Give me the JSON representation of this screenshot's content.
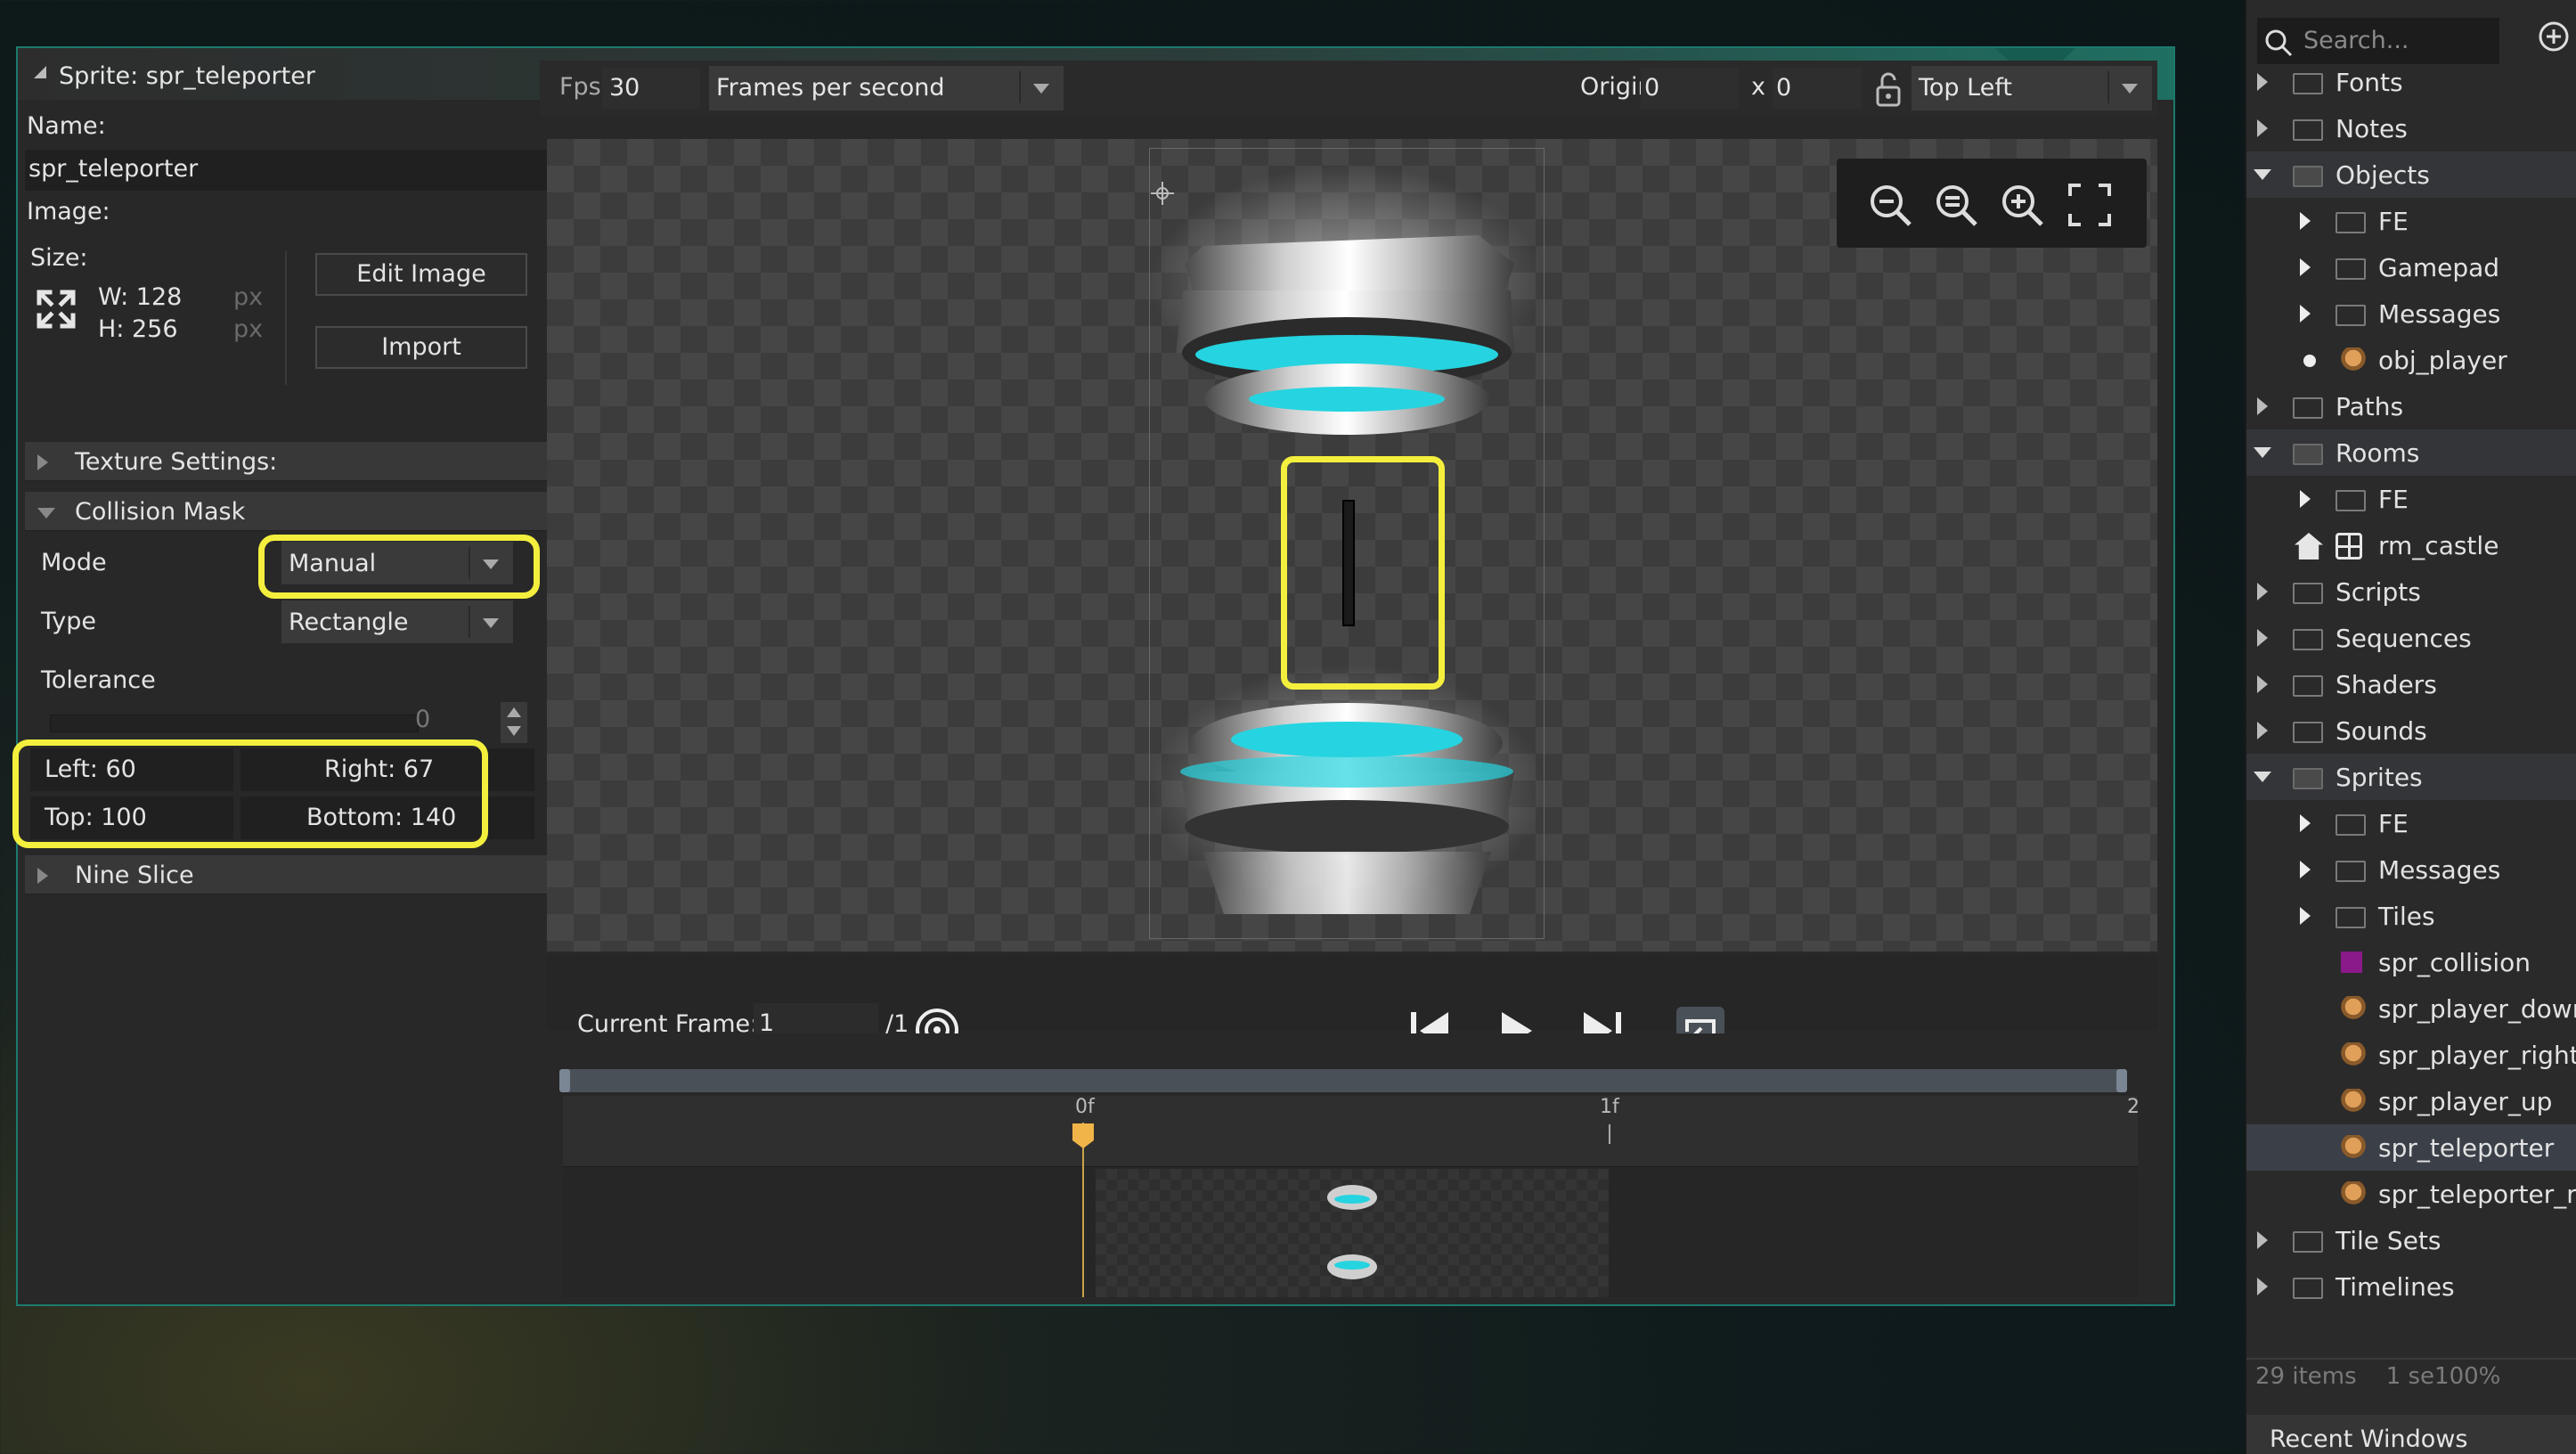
{
  "window": {
    "title": "Sprite: spr_teleporter",
    "close_glyph": "✕"
  },
  "properties": {
    "name_label": "Name:",
    "name_value": "spr_teleporter",
    "image_label": "Image:",
    "size_label": "Size:",
    "width_text": "W: 128",
    "height_text": "H: 256",
    "unit_px": "px",
    "edit_image_label": "Edit Image",
    "import_label": "Import",
    "texture_settings_label": "Texture Settings:",
    "collision_mask_label": "Collision Mask",
    "mode_label": "Mode",
    "mode_value": "Manual",
    "type_label": "Type",
    "type_value": "Rectangle",
    "tolerance_label": "Tolerance",
    "tolerance_value": "0",
    "left_text": "Left: 60",
    "right_text": "Right: 67",
    "top_text": "Top: 100",
    "bottom_text": "Bottom: 140",
    "nine_slice_label": "Nine Slice"
  },
  "toolbar": {
    "fps_label": "Fps",
    "fps_value": "30",
    "fps_mode": "Frames per second",
    "origin_label": "Origin",
    "origin_x": "0",
    "origin_sep": "x",
    "origin_y": "0",
    "origin_preset": "Top Left"
  },
  "playback": {
    "current_frame_label": "Current Frame:",
    "current_frame_value": "1",
    "frame_total": "/1"
  },
  "timeline": {
    "marker_0": "0f",
    "marker_1": "1f",
    "marker_2": "2"
  },
  "asset_browser": {
    "search_placeholder": "Search...",
    "items": [
      {
        "label": "Fonts",
        "kind": "folder",
        "level": 0,
        "expanded": false
      },
      {
        "label": "Notes",
        "kind": "folder",
        "level": 0,
        "expanded": false
      },
      {
        "label": "Objects",
        "kind": "folder",
        "level": 0,
        "expanded": true
      },
      {
        "label": "FE",
        "kind": "folder",
        "level": 1,
        "expanded": false
      },
      {
        "label": "Gamepad",
        "kind": "folder",
        "level": 1,
        "expanded": false
      },
      {
        "label": "Messages",
        "kind": "folder",
        "level": 1,
        "expanded": false
      },
      {
        "label": "obj_player",
        "kind": "object",
        "level": 1
      },
      {
        "label": "Paths",
        "kind": "folder",
        "level": 0,
        "expanded": false
      },
      {
        "label": "Rooms",
        "kind": "folder",
        "level": 0,
        "expanded": true
      },
      {
        "label": "FE",
        "kind": "folder",
        "level": 1,
        "expanded": false
      },
      {
        "label": "rm_castle",
        "kind": "room",
        "level": 1
      },
      {
        "label": "Scripts",
        "kind": "folder",
        "level": 0,
        "expanded": false
      },
      {
        "label": "Sequences",
        "kind": "folder",
        "level": 0,
        "expanded": false
      },
      {
        "label": "Shaders",
        "kind": "folder",
        "level": 0,
        "expanded": false
      },
      {
        "label": "Sounds",
        "kind": "folder",
        "level": 0,
        "expanded": false
      },
      {
        "label": "Sprites",
        "kind": "folder",
        "level": 0,
        "expanded": true
      },
      {
        "label": "FE",
        "kind": "folder",
        "level": 1,
        "expanded": false
      },
      {
        "label": "Messages",
        "kind": "folder",
        "level": 1,
        "expanded": false
      },
      {
        "label": "Tiles",
        "kind": "folder",
        "level": 1,
        "expanded": false
      },
      {
        "label": "spr_collision",
        "kind": "sprite",
        "level": 1
      },
      {
        "label": "spr_player_down",
        "kind": "sprite",
        "level": 1
      },
      {
        "label": "spr_player_right",
        "kind": "sprite",
        "level": 1
      },
      {
        "label": "spr_player_up",
        "kind": "sprite",
        "level": 1
      },
      {
        "label": "spr_teleporter",
        "kind": "sprite",
        "level": 1,
        "selected": true
      },
      {
        "label": "spr_teleporter_ra",
        "kind": "sprite",
        "level": 1
      },
      {
        "label": "Tile Sets",
        "kind": "folder",
        "level": 0,
        "expanded": false
      },
      {
        "label": "Timelines",
        "kind": "folder",
        "level": 0,
        "expanded": false
      }
    ],
    "status_text": "29 items    1 se100%",
    "recent_windows_label": "Recent Windows"
  },
  "colors": {
    "accent_teal": "#1f6f62",
    "highlight_yellow": "#f4ef3d",
    "selected_row": "#3a3f48",
    "teleporter_glow": "#25d4e0"
  }
}
